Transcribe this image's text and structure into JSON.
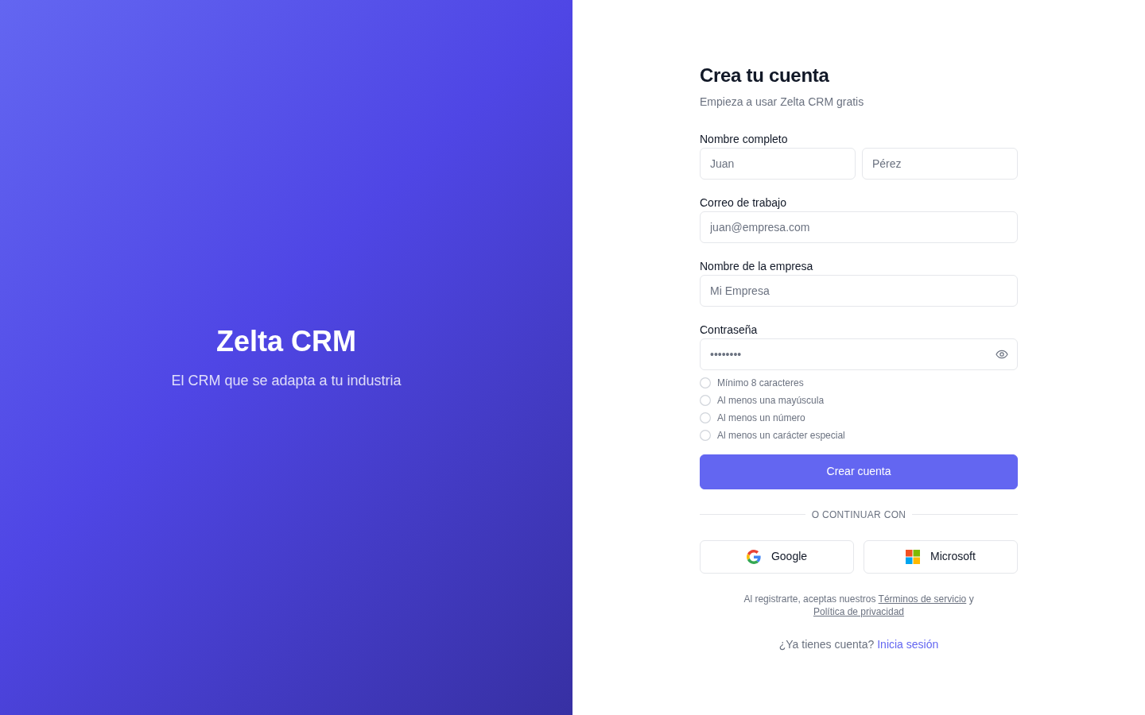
{
  "brand": {
    "title": "Zelta CRM",
    "tagline": "El CRM que se adapta a tu industria"
  },
  "form": {
    "title": "Crea tu cuenta",
    "subtitle": "Empieza a usar Zelta CRM gratis",
    "fields": [
      {
        "label": "Nombre completo",
        "inputs": [
          {
            "kind": "text",
            "placeholder": "Juan"
          },
          {
            "kind": "text",
            "placeholder": "Pérez"
          }
        ]
      },
      {
        "label": "Correo de trabajo",
        "inputs": [
          {
            "kind": "email",
            "placeholder": "juan@empresa.com"
          }
        ]
      },
      {
        "label": "Nombre de la empresa",
        "inputs": [
          {
            "kind": "text",
            "placeholder": "Mi Empresa"
          }
        ]
      },
      {
        "label": "Contraseña",
        "inputs": [
          {
            "kind": "password",
            "placeholder": "••••••••"
          }
        ]
      }
    ],
    "requirements": [
      {
        "text": "Mínimo 8 caracteres",
        "checked": false
      },
      {
        "text": "Al menos una mayúscula",
        "checked": false
      },
      {
        "text": "Al menos un número",
        "checked": false
      },
      {
        "text": "Al menos un carácter especial",
        "checked": false
      }
    ],
    "submit_button": "Crear cuenta",
    "divider": "O CONTINUAR CON",
    "social_buttons": [
      {
        "kind": "google",
        "label": "Google"
      },
      {
        "kind": "microsoft",
        "label": "Microsoft"
      }
    ],
    "terms": [
      {
        "kind": "text",
        "text": "Al registrarte, aceptas nuestros"
      },
      {
        "kind": "link",
        "text": "Términos de servicio"
      },
      {
        "kind": "text",
        "text": "y"
      },
      {
        "kind": "link",
        "text": "Política de privacidad"
      }
    ],
    "signin": {
      "question": "¿Ya tienes cuenta?",
      "link": "Inicia sesión"
    }
  }
}
